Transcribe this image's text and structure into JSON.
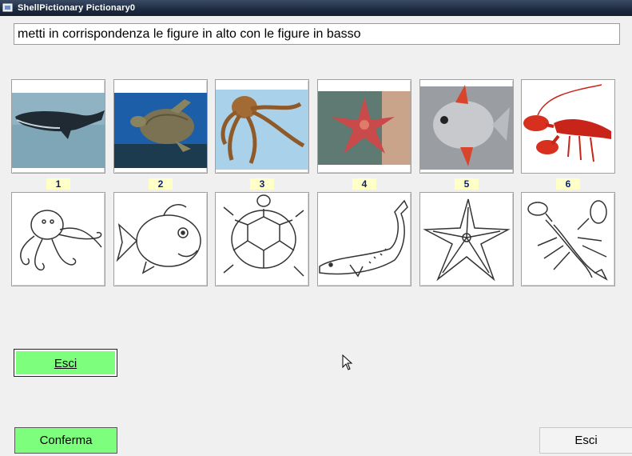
{
  "window": {
    "title": "ShellPictionary  Pictionary0"
  },
  "instruction": "metti in corrispondenza le figure in alto con le figure in basso",
  "top_cards": [
    {
      "icon": "whale-photo",
      "number": "1"
    },
    {
      "icon": "turtle-photo",
      "number": "2"
    },
    {
      "icon": "octopus-photo",
      "number": "3"
    },
    {
      "icon": "starfish-photo",
      "number": "4"
    },
    {
      "icon": "fish-photo",
      "number": "5"
    },
    {
      "icon": "lobster-photo",
      "number": "6"
    }
  ],
  "bottom_cards": [
    {
      "icon": "octopus-drawing"
    },
    {
      "icon": "fish-drawing"
    },
    {
      "icon": "turtle-drawing"
    },
    {
      "icon": "whale-drawing"
    },
    {
      "icon": "starfish-drawing"
    },
    {
      "icon": "lobster-drawing"
    }
  ],
  "buttons": {
    "esci_left": "Esci",
    "conferma": "Conferma",
    "esci_right": "Esci"
  },
  "colors": {
    "green_button": "#7dff7d",
    "number_bg": "#ffffc8",
    "number_text": "#0b1f7a"
  }
}
